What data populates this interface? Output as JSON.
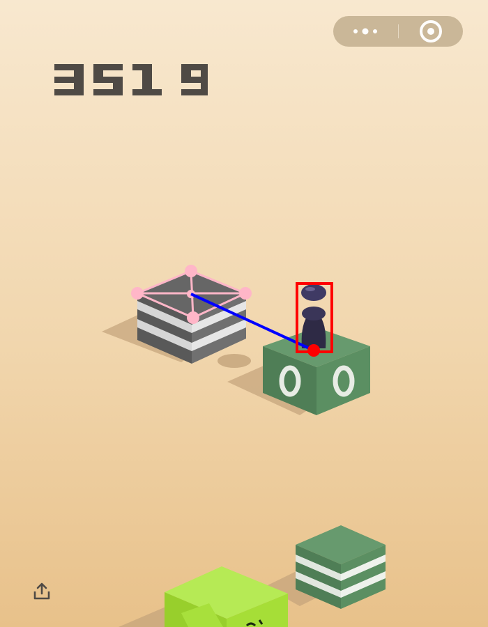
{
  "game": {
    "score": "3519",
    "colors": {
      "background_top": "#f8e8cf",
      "background_bottom": "#e8c18a",
      "score_digits": "#4f4a45",
      "capsule": "#c8b596",
      "green_block": "#5a8f63",
      "gray_block": "#6f6f6f",
      "lime_block": "#aee642",
      "player": "#2e2a45",
      "pink_overlay": "#ffb6c8",
      "blue_line": "#0000ff",
      "red_box": "#ff0000"
    },
    "icons": {
      "more": "more-dots-icon",
      "close": "target-close-icon",
      "share": "share-icon"
    }
  }
}
